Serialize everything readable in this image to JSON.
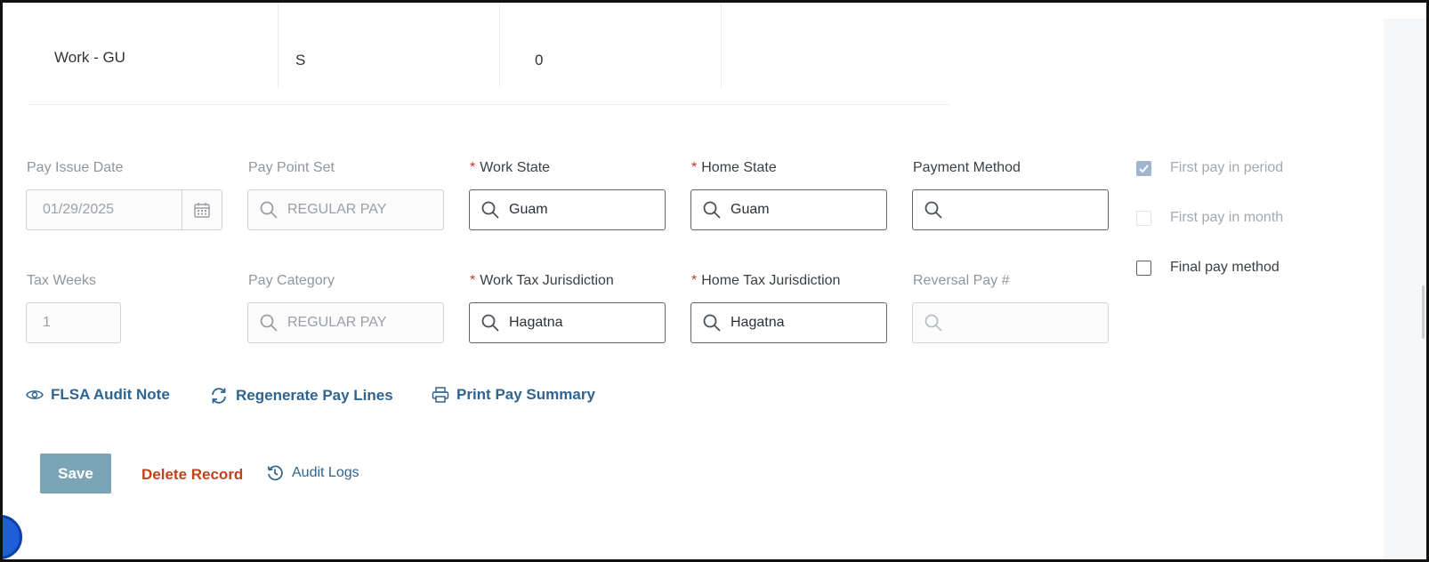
{
  "table_row": {
    "col1": "Work - GU",
    "col2": "S",
    "col3": "0"
  },
  "form": {
    "pay_issue_date": {
      "label": "Pay Issue Date",
      "value": "01/29/2025"
    },
    "pay_point_set": {
      "label": "Pay Point Set",
      "value": "REGULAR PAY"
    },
    "work_state": {
      "required_mark": "*",
      "label": "Work State",
      "value": "Guam"
    },
    "home_state": {
      "required_mark": "*",
      "label": "Home State",
      "value": "Guam"
    },
    "payment_method": {
      "label": "Payment Method",
      "value": ""
    },
    "tax_weeks": {
      "label": "Tax Weeks",
      "value": "1"
    },
    "pay_category": {
      "label": "Pay Category",
      "value": "REGULAR PAY"
    },
    "work_tax_jurisdiction": {
      "required_mark": "*",
      "label": "Work Tax Jurisdiction",
      "value": "Hagatna"
    },
    "home_tax_jurisdiction": {
      "required_mark": "*",
      "label": "Home Tax Jurisdiction",
      "value": "Hagatna"
    },
    "reversal_pay": {
      "label": "Reversal Pay #",
      "value": ""
    }
  },
  "checkboxes": {
    "first_pay_in_period": {
      "label": "First pay in period",
      "checked": true,
      "disabled": true
    },
    "first_pay_in_month": {
      "label": "First pay in month",
      "checked": false,
      "disabled": true
    },
    "final_pay_method": {
      "label": "Final pay method",
      "checked": false,
      "disabled": false
    }
  },
  "actions": {
    "flsa_audit_note": "FLSA Audit Note",
    "regenerate_pay_lines": "Regenerate Pay Lines",
    "print_pay_summary": "Print Pay Summary"
  },
  "footer": {
    "save": "Save",
    "delete_record": "Delete Record",
    "audit_logs": "Audit Logs"
  },
  "icons": {
    "search": "search-icon",
    "calendar": "calendar-icon",
    "eye": "eye-icon",
    "refresh": "refresh-icon",
    "printer": "printer-icon",
    "history": "history-icon"
  },
  "colors": {
    "link": "#2f6490",
    "danger": "#c0431d",
    "save_button": "#7ca4b7",
    "required": "#c0392b"
  }
}
